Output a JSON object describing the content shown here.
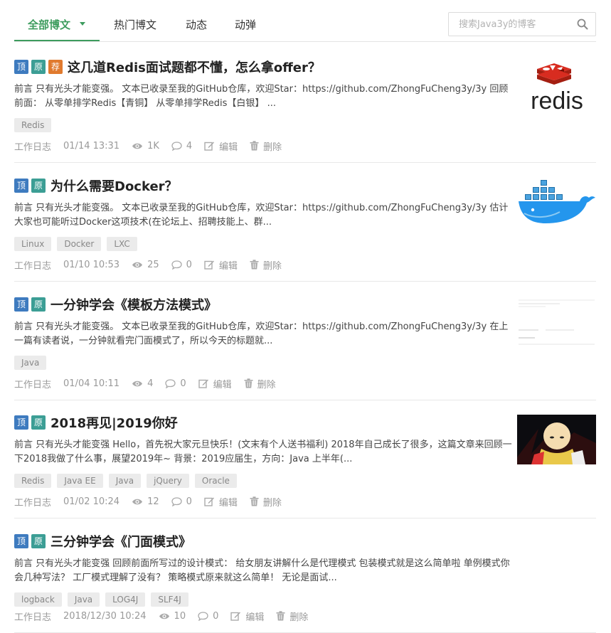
{
  "nav": {
    "tabs": [
      {
        "label": "全部博文"
      },
      {
        "label": "热门博文"
      },
      {
        "label": "动态"
      },
      {
        "label": "动弹"
      }
    ],
    "search_placeholder": "搜索Java3y的博客"
  },
  "labels": {
    "top": "顶",
    "original": "原",
    "recommend": "荐",
    "edit": "编辑",
    "delete": "删除"
  },
  "articles": [
    {
      "title": "这几道Redis面试题都不懂，怎么拿offer？",
      "recommended": true,
      "summary": "前言 只有光头才能变强。 文本已收录至我的GitHub仓库，欢迎Star：https://github.com/ZhongFuCheng3y/3y 回顾前面： 从零单排学Redis【青铜】 从零单排学Redis【白银】 ...",
      "tags": [
        "Redis"
      ],
      "category": "工作日志",
      "date": "01/14 13:31",
      "views": "1K",
      "comments": "4",
      "thumb": "redis"
    },
    {
      "title": "为什么需要Docker？",
      "recommended": false,
      "summary": "前言 只有光头才能变强。 文本已收录至我的GitHub仓库，欢迎Star：https://github.com/ZhongFuCheng3y/3y 估计大家也可能听过Docker这项技术(在论坛上、招聘技能上、群...",
      "tags": [
        "Linux",
        "Docker",
        "LXC"
      ],
      "category": "工作日志",
      "date": "01/10 10:53",
      "views": "25",
      "comments": "0",
      "thumb": "docker"
    },
    {
      "title": "一分钟学会《模板方法模式》",
      "recommended": false,
      "summary": "前言 只有光头才能变强。 文本已收录至我的GitHub仓库，欢迎Star：https://github.com/ZhongFuCheng3y/3y 在上一篇有读者说，一分钟就看完门面模式了，所以今天的标题就...",
      "tags": [
        "Java"
      ],
      "category": "工作日志",
      "date": "01/04 10:11",
      "views": "4",
      "comments": "0",
      "thumb": "doc"
    },
    {
      "title": "2018再见|2019你好",
      "recommended": false,
      "summary": "前言 只有光头才能变强 Hello，首先祝大家元旦快乐！(文末有个人送书福利) 2018年自己成长了很多，这篇文章来回顾一下2018我做了什么事，展望2019年~ 背景：2019应届生，方向：Java 上半年(...",
      "tags": [
        "Redis",
        "Java EE",
        "Java",
        "jQuery",
        "Oracle"
      ],
      "category": "工作日志",
      "date": "01/02 10:24",
      "views": "12",
      "comments": "0",
      "thumb": "anime"
    },
    {
      "title": "三分钟学会《门面模式》",
      "recommended": false,
      "summary": "前言 只有光头才能变强 回顾前面所写过的设计模式： 给女朋友讲解什么是代理模式 包装模式就是这么简单啦 单例模式你会几种写法？ 工厂模式理解了没有？ 策略模式原来就这么简单！ 无论是面试...",
      "tags": [
        "logback",
        "Java",
        "LOG4J",
        "SLF4J"
      ],
      "category": "工作日志",
      "date": "2018/12/30 10:24",
      "views": "10",
      "comments": "0",
      "thumb": ""
    }
  ],
  "thumb_text": {
    "redis": "redis"
  },
  "colors": {
    "accent": "#3d9c5e",
    "flag_top": "#3e7bbf",
    "flag_original": "#3c9e95",
    "flag_recommend": "#e07a2e",
    "redis_red": "#c6302b"
  }
}
